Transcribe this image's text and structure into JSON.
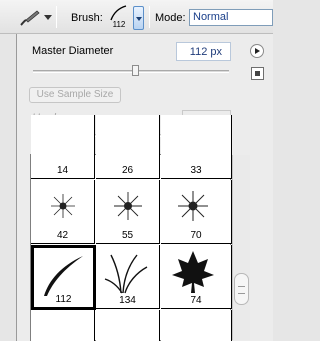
{
  "options_bar": {
    "tool_icon": "brush-tool-icon",
    "brush_label": "Brush:",
    "brush_size_preview": "112",
    "mode_label": "Mode:",
    "mode_value": "Normal"
  },
  "panel": {
    "master_diameter_label": "Master Diameter",
    "master_diameter_value": "112 px",
    "slider_fraction": 0.6,
    "use_sample_size_label": "Use Sample Size",
    "hardness_label": "Hardness:",
    "brushes": [
      {
        "size": "14",
        "icon": "soft-round-brush"
      },
      {
        "size": "26",
        "icon": "soft-round-brush"
      },
      {
        "size": "33",
        "icon": "soft-round-brush"
      },
      {
        "size": "42",
        "icon": "star-burst-brush"
      },
      {
        "size": "55",
        "icon": "star-burst-brush"
      },
      {
        "size": "70",
        "icon": "star-burst-brush"
      },
      {
        "size": "112",
        "icon": "curved-stroke-brush"
      },
      {
        "size": "134",
        "icon": "grass-brush"
      },
      {
        "size": "74",
        "icon": "maple-leaf-brush"
      }
    ]
  }
}
